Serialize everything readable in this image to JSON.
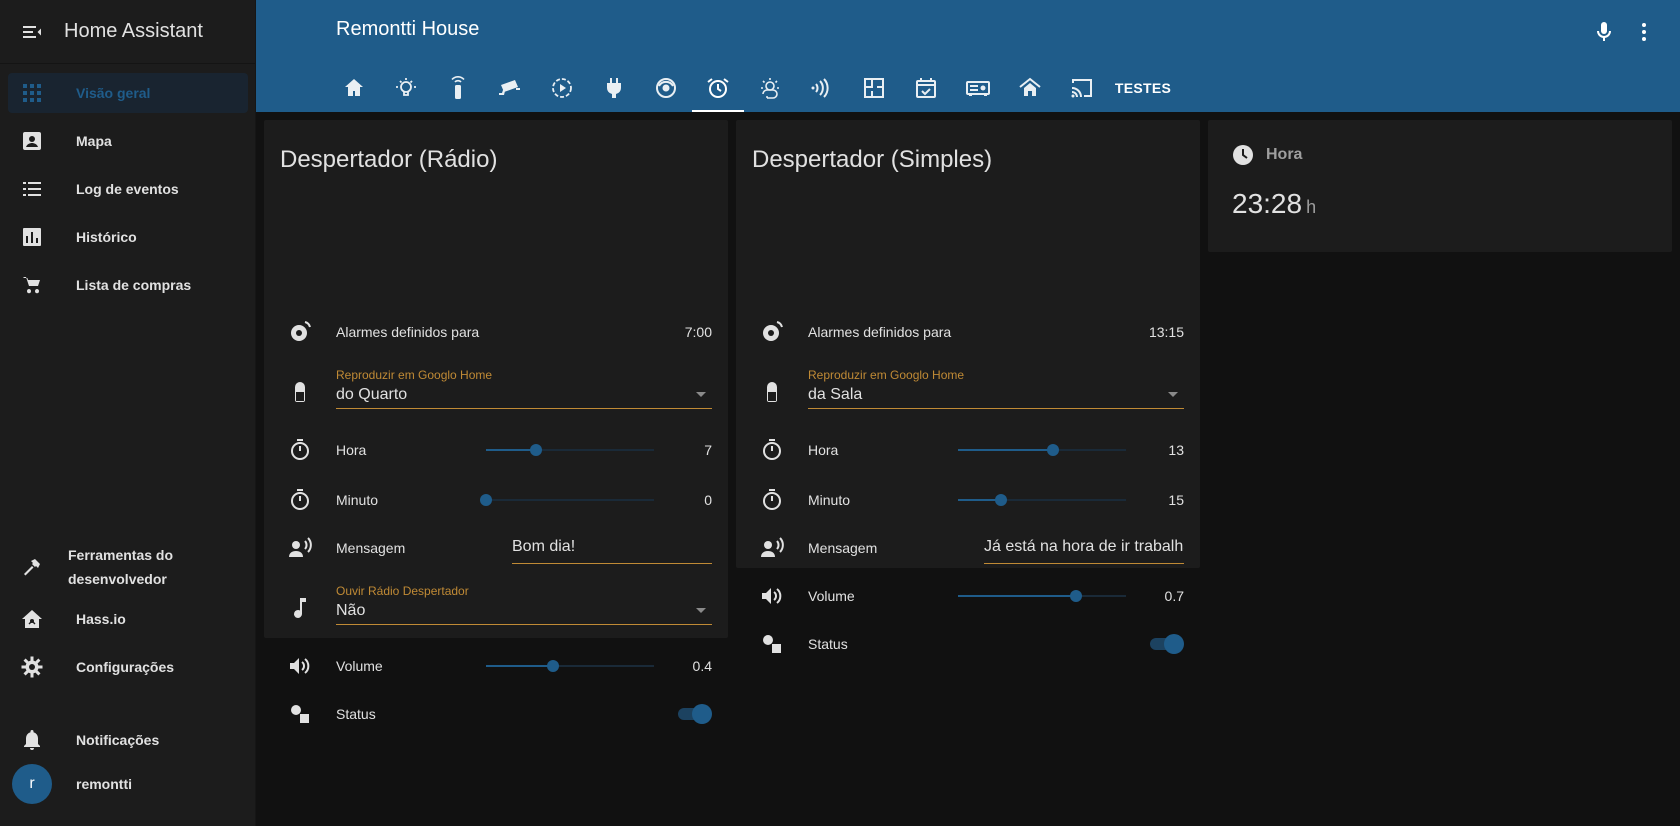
{
  "app": {
    "title": "Home Assistant"
  },
  "sidebar": {
    "items": [
      {
        "label": "Visão geral",
        "icon": "view-dashboard-icon",
        "active": true
      },
      {
        "label": "Mapa",
        "icon": "account-box-icon"
      },
      {
        "label": "Log de eventos",
        "icon": "format-list-bulleted-icon"
      },
      {
        "label": "Histórico",
        "icon": "chart-box-icon"
      },
      {
        "label": "Lista de compras",
        "icon": "cart-icon"
      }
    ],
    "bottom": {
      "dev_tools_line1": "Ferramentas do",
      "dev_tools_line2": "desenvolvedor",
      "hassio": "Hass.io",
      "config": "Configurações",
      "notifications": "Notificações",
      "user_initial": "r",
      "user_name": "remontti"
    }
  },
  "header": {
    "title": "Remontti House",
    "tabs": [
      "home-icon",
      "lightbulb-icon",
      "remote-icon",
      "cctv-icon",
      "play-circle-icon",
      "power-plug-icon",
      "robot-vacuum-icon",
      "alarm-icon",
      "weather-icon",
      "nfc-icon",
      "floor-plan-icon",
      "calendar-check-icon",
      "receiver-icon",
      "home-roof-icon",
      "cast-icon"
    ],
    "text_tab": "TESTES",
    "active_tab_index": 7,
    "colors": {
      "primary": "#1f5c8a",
      "accent": "#c08a35",
      "background": "#111111",
      "card": "#1c1c1c"
    }
  },
  "cards": {
    "radio": {
      "title": "Despertador (Rádio)",
      "alarm_label": "Alarmes definidos para",
      "alarm_value": "7:00",
      "select1_label": "Reproduzir em Googlo Home",
      "select1_value": "do Quarto",
      "hora_label": "Hora",
      "hora_value": "7",
      "hora_fraction": 0.3,
      "minuto_label": "Minuto",
      "minuto_value": "0",
      "minuto_fraction": 0.0,
      "mensagem_label": "Mensagem",
      "mensagem_value": "Bom dia!",
      "select2_label": "Ouvir Rádio Despertador",
      "select2_value": "Não",
      "volume_label": "Volume",
      "volume_value": "0.4",
      "volume_fraction": 0.4,
      "status_label": "Status",
      "status_on": true
    },
    "simples": {
      "title": "Despertador (Simples)",
      "alarm_label": "Alarmes definidos para",
      "alarm_value": "13:15",
      "select1_label": "Reproduzir em Googlo Home",
      "select1_value": "da Sala",
      "hora_label": "Hora",
      "hora_value": "13",
      "hora_fraction": 0.565,
      "minuto_label": "Minuto",
      "minuto_value": "15",
      "minuto_fraction": 0.254,
      "mensagem_label": "Mensagem",
      "mensagem_value": "Já está na hora de ir trabalhar",
      "volume_label": "Volume",
      "volume_value": "0.7",
      "volume_fraction": 0.7,
      "status_label": "Status",
      "status_on": true
    },
    "clock": {
      "label": "Hora",
      "value": "23:28",
      "unit": "h"
    }
  }
}
